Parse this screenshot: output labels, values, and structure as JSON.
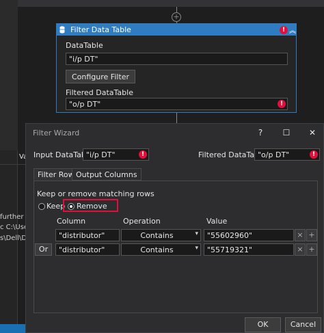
{
  "activity": {
    "title": "Filter Data Table",
    "datatable_label": "DataTable",
    "datatable_value": "\"i/p DT\"",
    "configure_button": "Configure Filter",
    "filtered_label": "Filtered DataTable",
    "filtered_value": "\"o/p DT\"",
    "error_glyph": "!"
  },
  "background": {
    "side_tab": "Va",
    "lines": [
      "further ac",
      "c C:\\User",
      "s\\Dell\\Do"
    ]
  },
  "dialog": {
    "title": "Filter Wizard",
    "help_glyph": "?",
    "maximize_glyph": "☐",
    "close_glyph": "✕",
    "input_label": "Input DataTable",
    "input_value": "\"i/p DT\"",
    "output_label": "Filtered DataTable",
    "output_value": "\"o/p DT\"",
    "tabs": [
      "Filter Rows",
      "Output Columns"
    ],
    "section_label": "Keep or remove matching rows",
    "keep_label": "Keep",
    "remove_label": "Remove",
    "columns": [
      "Column",
      "Operation",
      "Value"
    ],
    "rows": [
      {
        "prefix": "",
        "column": "\"distributor\"",
        "operation": "Contains",
        "value": "\"55602960\""
      },
      {
        "prefix": "Or",
        "column": "\"distributor\"",
        "operation": "Contains",
        "value": "\"55719321\""
      }
    ],
    "remove_row_glyph": "×",
    "add_row_glyph": "+",
    "ok_label": "OK",
    "cancel_label": "Cancel"
  },
  "colors": {
    "accent": "#2f7dc0",
    "error": "#e0103a",
    "background": "#1e1e1e",
    "dialog": "#2d2d30"
  }
}
